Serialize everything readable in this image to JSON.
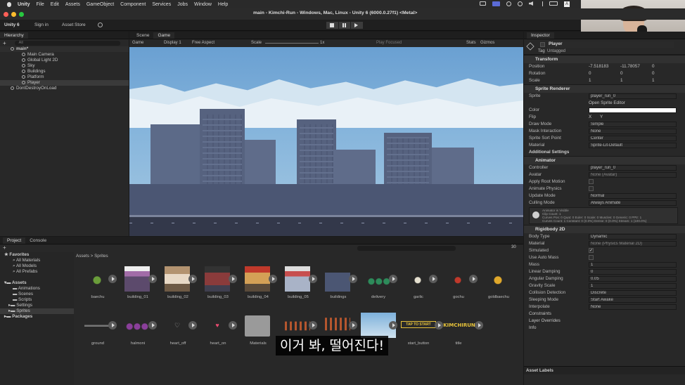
{
  "menubar": {
    "apple": "",
    "items": [
      "Unity",
      "File",
      "Edit",
      "Assets",
      "GameObject",
      "Component",
      "Services",
      "Jobs",
      "Window",
      "Help"
    ],
    "battery_badge": "A"
  },
  "window": {
    "title": "main - Kimchi-Run - Windows, Mac, Linux - Unity 6 (6000.0.27f1) <Metal>"
  },
  "toolbar": {
    "account": "Unity 6",
    "sign_in": "Sign in",
    "asset_store": "Asset Store"
  },
  "hierarchy": {
    "tab": "Hierarchy",
    "search_placeholder": "All",
    "scene": "main*",
    "children": [
      "Main Camera",
      "Global Light 2D",
      "Sky",
      "Buildings",
      "Platform",
      "Player"
    ],
    "dont_destroy": "DontDestroyOnLoad"
  },
  "game_view": {
    "tab_scene": "Scene",
    "tab_game": "Game",
    "mode": "Game",
    "display": "Display 1",
    "aspect": "Free Aspect",
    "scale_label": "Scale",
    "scale_value": "1x",
    "play_focused": "Play Focused",
    "stats": "Stats",
    "gizmos": "Gizmos",
    "sky_color": "#6fa6d6",
    "building_color": "#4b5673"
  },
  "inspector": {
    "tab": "Inspector",
    "object_name": "Player",
    "tag_label": "Tag",
    "tag_value": "Untagged",
    "transform": {
      "title": "Transform",
      "position_label": "Position",
      "position": {
        "x": "-7.518183",
        "y": "-11.78057",
        "z": "0"
      },
      "rotation_label": "Rotation",
      "rotation": {
        "x": "0",
        "y": "0",
        "z": "0"
      },
      "scale_label": "Scale",
      "scale": {
        "x": "1",
        "y": "1",
        "z": "1"
      }
    },
    "sprite_renderer": {
      "title": "Sprite Renderer",
      "sprite_label": "Sprite",
      "sprite_value": "player_run_0",
      "open_editor": "Open Sprite Editor",
      "color_label": "Color",
      "flip_label": "Flip",
      "flip_x": "X",
      "flip_y": "Y",
      "draw_mode_label": "Draw Mode",
      "draw_mode": "Simple",
      "mask_label": "Mask Interaction",
      "mask": "None",
      "sort_point_label": "Sprite Sort Point",
      "sort_point": "Center",
      "material_label": "Material",
      "material": "Sprite-Lit-Default",
      "additional": "Additional Settings"
    },
    "animator": {
      "title": "Animator",
      "controller_label": "Controller",
      "controller": "player_run_0",
      "avatar_label": "Avatar",
      "avatar": "None (Avatar)",
      "root_motion_label": "Apply Root Motion",
      "animate_physics_label": "Animate Physics",
      "update_mode_label": "Update Mode",
      "update_mode": "Normal",
      "culling_label": "Culling Mode",
      "culling": "Always Animate",
      "info_1": "Animator is Visible",
      "info_2": "Clip Count: 1",
      "info_3": "Curves Pos: 0 Quat: 0 Euler: 0 Scale: 0 Muscles: 0 Generic: 0 PPtr: 1",
      "info_4": "Curves Count: 1 Constant: 0 (0.0%) Dense: 0 (0.0%) Stream: 1 (100.0%)"
    },
    "rigidbody": {
      "title": "Rigidbody 2D",
      "body_type_label": "Body Type",
      "body_type": "Dynamic",
      "material_label": "Material",
      "material": "None (Physics Material 2D)",
      "simulated_label": "Simulated",
      "auto_mass_label": "Use Auto Mass",
      "mass_label": "Mass",
      "mass": "1",
      "linear_damping_label": "Linear Damping",
      "linear_damping": "0",
      "angular_damping_label": "Angular Damping",
      "angular_damping": "0.05",
      "gravity_label": "Gravity Scale",
      "gravity": "1",
      "collision_label": "Collision Detection",
      "collision": "Discrete",
      "sleeping_label": "Sleeping Mode",
      "sleeping": "Start Awake",
      "interpolate_label": "Interpolate",
      "interpolate": "None",
      "constraints": "Constraints",
      "layer_overrides": "Layer Overrides",
      "info": "Info"
    },
    "asset_labels": "Asset Labels"
  },
  "project": {
    "tab_project": "Project",
    "tab_console": "Console",
    "favorites": "Favorites",
    "fav_items": [
      "All Materials",
      "All Models",
      "All Prefabs"
    ],
    "assets": "Assets",
    "asset_folders": [
      "Animations",
      "Scenes",
      "Scripts",
      "Settings",
      "Sprites"
    ],
    "packages": "Packages",
    "breadcrumb_root": "Assets",
    "breadcrumb_sep": ">",
    "breadcrumb_current": "Sprites",
    "count": "30",
    "row1": [
      "baechu",
      "building_01",
      "building_02",
      "building_03",
      "building_04",
      "building_05",
      "buildings",
      "delivery",
      "garlic",
      "gochu",
      "goldbaechu"
    ],
    "row2": [
      "ground",
      "halmoni",
      "heart_off",
      "heart_on",
      "Materials",
      "",
      "",
      "start_button",
      "title"
    ],
    "start_button_text": "TAP TO START",
    "title_text": "KIMCHIRUN"
  },
  "subtitle": "이거 봐, 떨어진다!"
}
